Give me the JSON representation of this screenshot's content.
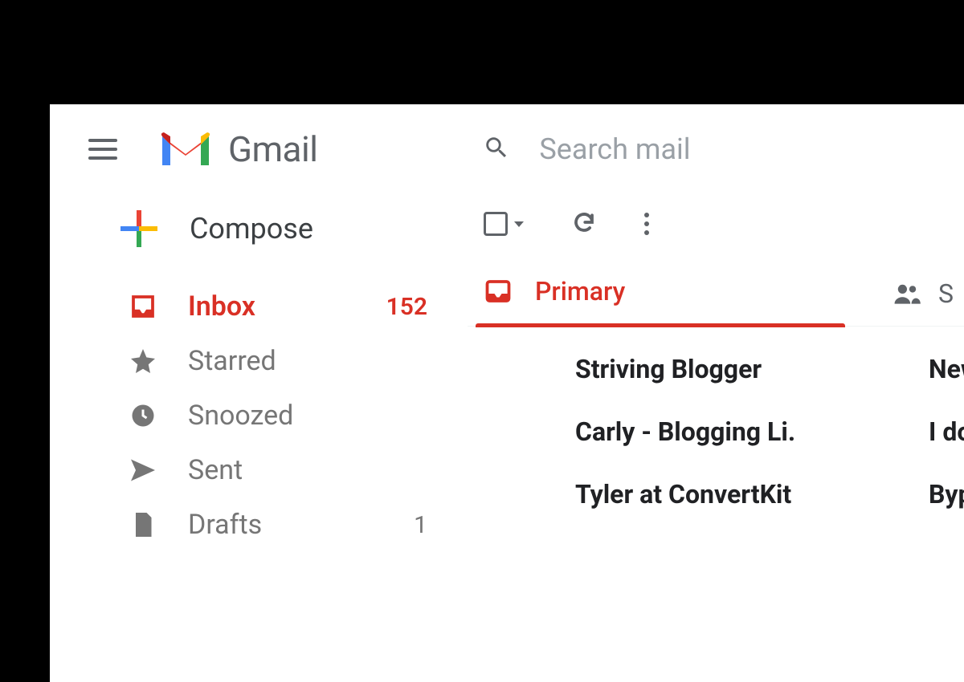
{
  "header": {
    "app_name": "Gmail",
    "search_placeholder": "Search mail"
  },
  "sidebar": {
    "compose_label": "Compose",
    "items": [
      {
        "id": "inbox",
        "label": "Inbox",
        "count": "152",
        "active": true
      },
      {
        "id": "starred",
        "label": "Starred",
        "count": ""
      },
      {
        "id": "snoozed",
        "label": "Snoozed",
        "count": ""
      },
      {
        "id": "sent",
        "label": "Sent",
        "count": ""
      },
      {
        "id": "drafts",
        "label": "Drafts",
        "count": "1"
      }
    ]
  },
  "tabs": {
    "primary_label": "Primary",
    "social_label": "S"
  },
  "emails": [
    {
      "sender": "Striving Blogger",
      "subject": "New B"
    },
    {
      "sender": "Carly - Blogging Li.",
      "subject": "I don t"
    },
    {
      "sender": "Tyler at ConvertKit",
      "subject": "Bypas"
    }
  ]
}
